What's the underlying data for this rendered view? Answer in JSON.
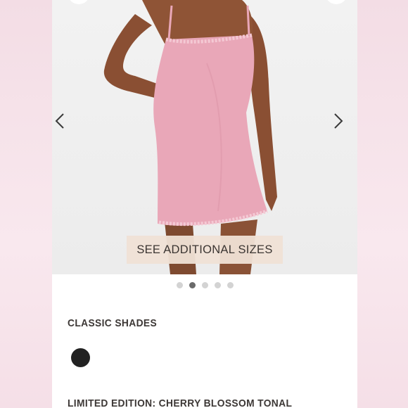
{
  "carousel": {
    "prev_icon": "chevron-left-icon",
    "next_icon": "chevron-right-icon",
    "sizes_button_label": "SEE ADDITIONAL SIZES",
    "dot_count": 5,
    "active_dot": 2
  },
  "product": {
    "dress_color": "#e9a7b8",
    "skin_color": "#8a4f33"
  },
  "sections": {
    "classic_shades_title": "CLASSIC SHADES",
    "limited_edition_title": "LIMITED EDITION: CHERRY BLOSSOM TONAL",
    "swatch_color": "#222222"
  }
}
